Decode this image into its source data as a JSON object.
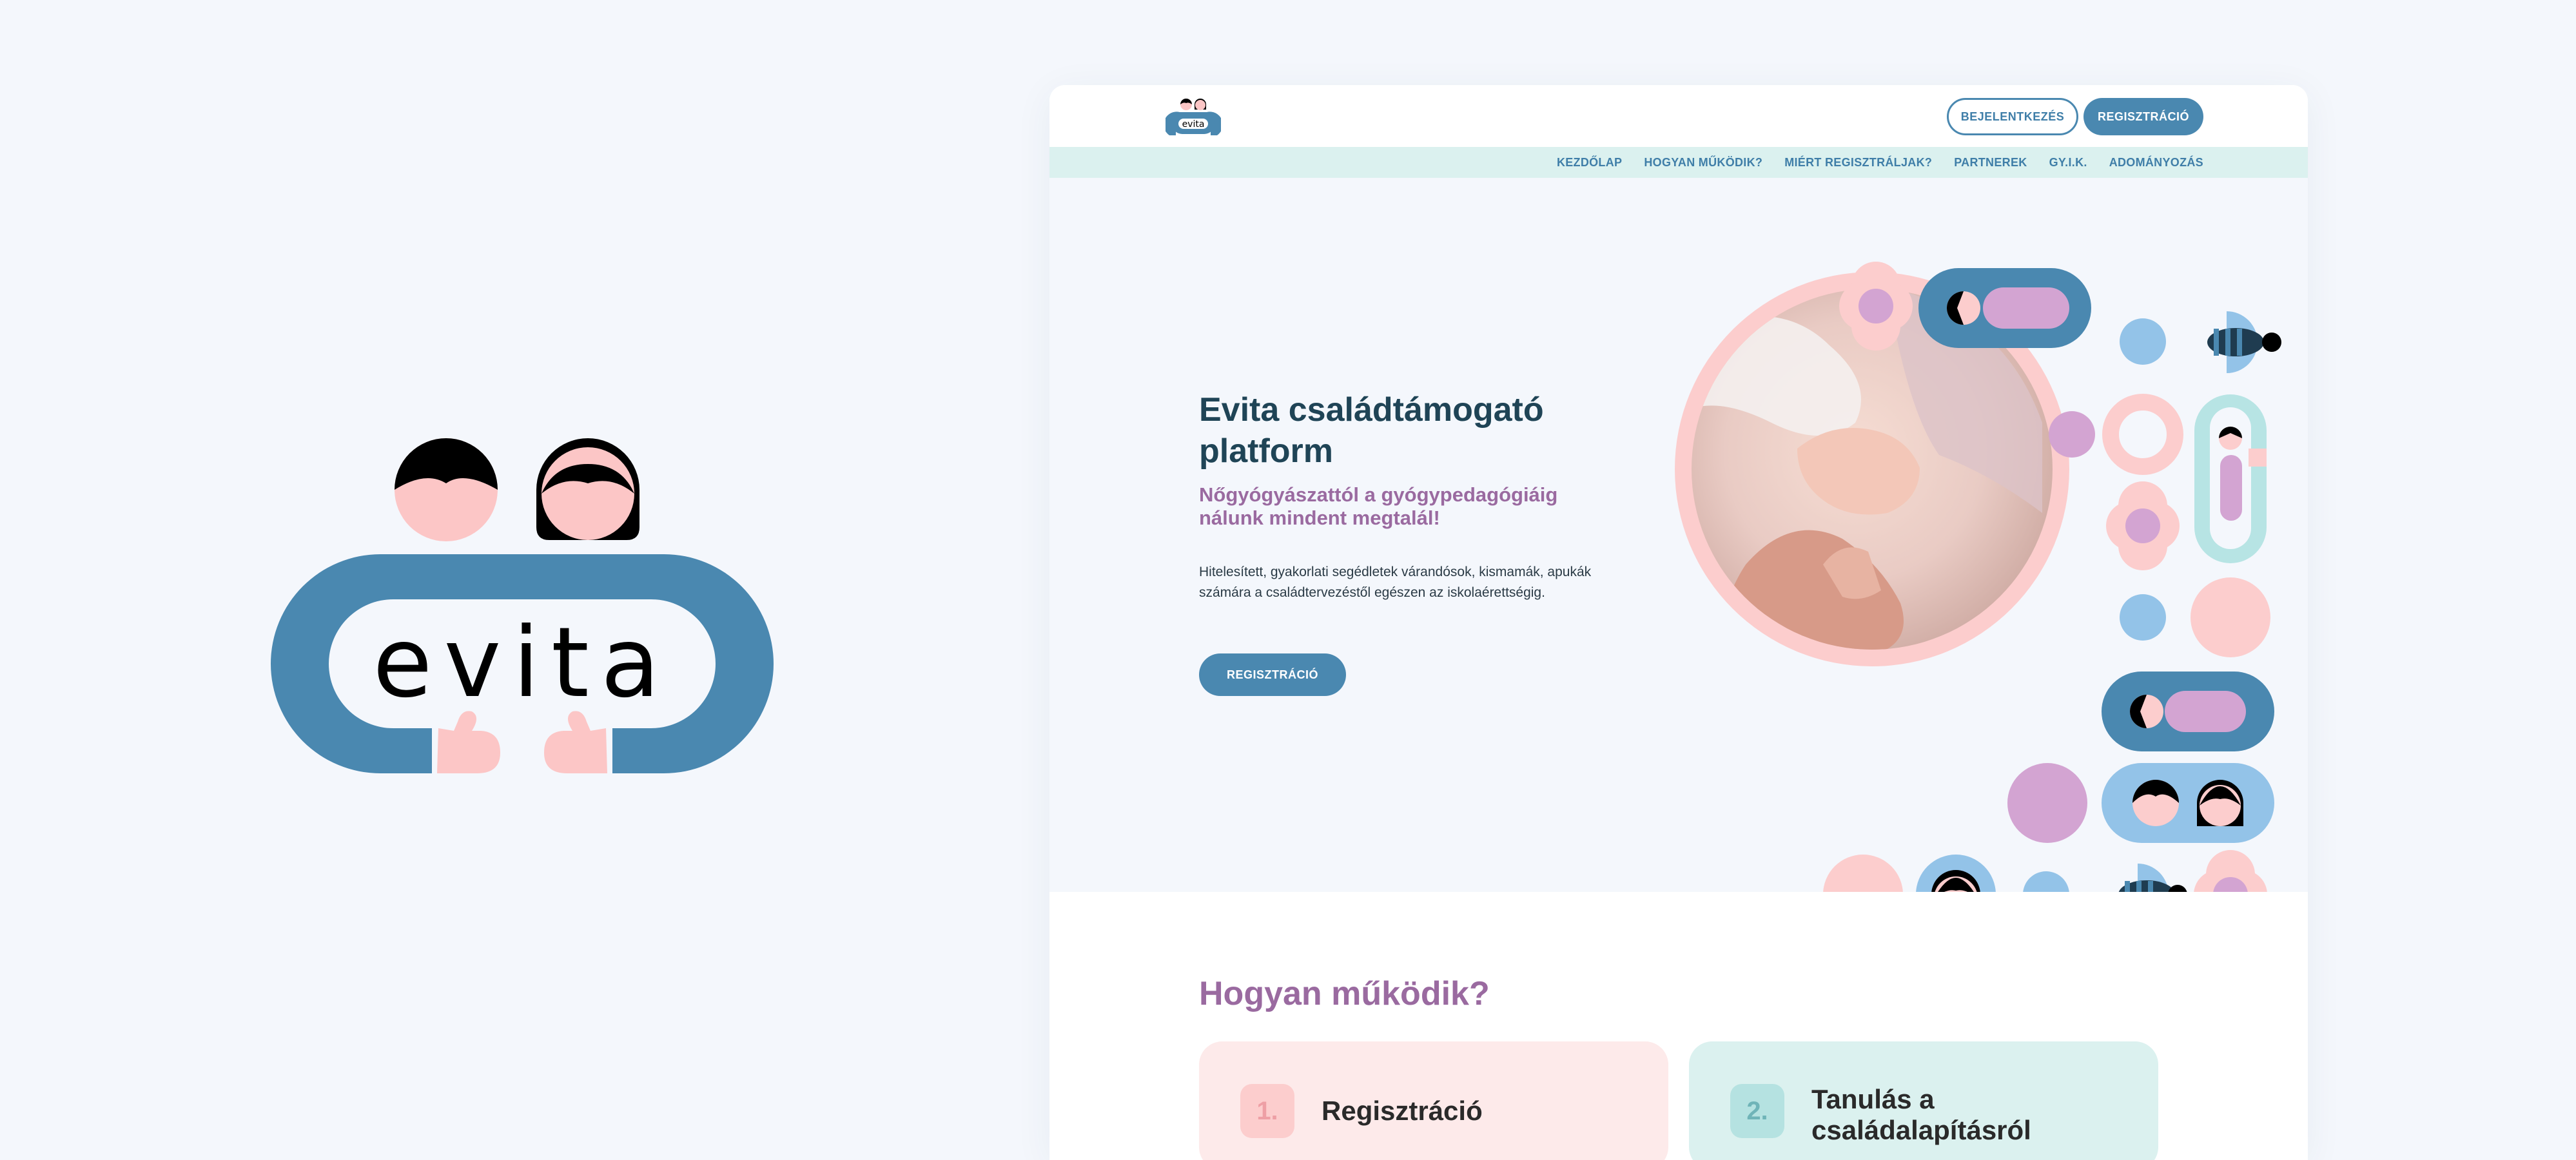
{
  "brand": {
    "wordmark": "evita"
  },
  "header": {
    "login_label": "BEJELENTKEZÉS",
    "register_label": "REGISZTRÁCIÓ"
  },
  "nav": {
    "items": [
      {
        "label": "KEZDŐLAP"
      },
      {
        "label": "HOGYAN MŰKÖDIK?"
      },
      {
        "label": "MIÉRT REGISZTRÁLJAK?"
      },
      {
        "label": "PARTNEREK"
      },
      {
        "label": "GY.I.K."
      },
      {
        "label": "ADOMÁNYOZÁS"
      }
    ]
  },
  "hero": {
    "title": "Evita családtámogató platform",
    "subtitle": "Nőgyógyászattól a gyógypedagógiáig nálunk mindent megtalál!",
    "description": "Hitelesített, gyakorlati segédletek várandósok, kismamák, apukák számára a családtervezéstől egészen az iskolaérettségig.",
    "cta_label": "REGISZTRÁCIÓ"
  },
  "how": {
    "title": "Hogyan működik?",
    "steps": [
      {
        "number": "1.",
        "label": "Regisztráció"
      },
      {
        "number": "2.",
        "label": "Tanulás a családalapításról"
      }
    ]
  },
  "colors": {
    "primary_blue": "#4a88b0",
    "dark_text": "#1f4456",
    "purple": "#9a6aa0",
    "pink": "#fccdcd",
    "mint": "#dbf1ef",
    "light_blue": "#93c3e8",
    "lilac": "#d3a4d2",
    "background": "#f4f7fc"
  }
}
